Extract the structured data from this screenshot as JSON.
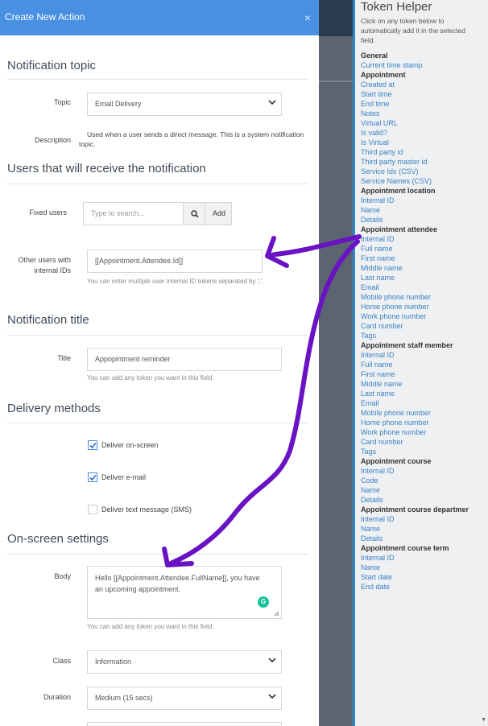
{
  "modal": {
    "title": "Create New Action",
    "close_glyph": "×"
  },
  "notification_topic": {
    "heading": "Notification topic",
    "topic_label": "Topic",
    "topic_value": "Email Delivery",
    "description_label": "Description",
    "description_text": "Used when a user sends a direct message. This is a system notification topic."
  },
  "receivers": {
    "heading": "Users that will receive the notification",
    "fixed_users_label": "Fixed users",
    "search_placeholder": "Type to search...",
    "add_label": "Add",
    "other_users_label": "Other users with internal IDs",
    "other_users_value": "[[Appointment.Attendee.Id]]",
    "other_users_help": "You can enter multiple user internal ID tokens separated by ';'."
  },
  "notification_title": {
    "heading": "Notification title",
    "title_label": "Title",
    "title_value": "Appopintment reminder",
    "title_help": "You can add any token you want in this field."
  },
  "delivery_methods": {
    "heading": "Delivery methods",
    "options": [
      {
        "label": "Deliver on-screen",
        "checked": true
      },
      {
        "label": "Deliver e-mail",
        "checked": true
      },
      {
        "label": "Deliver text message (SMS)",
        "checked": false
      }
    ]
  },
  "onscreen": {
    "heading": "On-screen settings",
    "body_label": "Body",
    "body_value": "Hello [[Appointment.Attendee.FullName]], you have an upcoming appointment.",
    "body_help": "You can add any token you want in this field.",
    "class_label": "Class",
    "class_value": "Information",
    "duration_label": "Duration",
    "duration_value": "Medium (15 secs)"
  },
  "token_helper": {
    "title": "Token Helper",
    "intro": "Click on any token below to automatically add it in the selected field.",
    "groups": [
      {
        "name": "General",
        "tokens": [
          "Current time stamp"
        ]
      },
      {
        "name": "Appointment",
        "tokens": [
          "Created at",
          "Start time",
          "End time",
          "Notes",
          "Virtual URL",
          "Is valid?",
          "Is Virtual",
          "Third party id",
          "Third party master id",
          "Service Ids (CSV)",
          "Service Names (CSV)"
        ]
      },
      {
        "name": "Appointment location",
        "tokens": [
          "Internal ID",
          "Name",
          "Details"
        ]
      },
      {
        "name": "Appointment attendee",
        "tokens": [
          "Internal ID",
          "Full name",
          "First name",
          "Middle name",
          "Last name",
          "Email",
          "Mobile phone number",
          "Home phone number",
          "Work phone number",
          "Card number",
          "Tags"
        ]
      },
      {
        "name": "Appointment staff member",
        "tokens": [
          "Internal ID",
          "Full name",
          "First name",
          "Middle name",
          "Last name",
          "Email",
          "Mobile phone number",
          "Home phone number",
          "Work phone number",
          "Card number",
          "Tags"
        ]
      },
      {
        "name": "Appointment course",
        "tokens": [
          "Internal ID",
          "Code",
          "Name",
          "Details"
        ]
      },
      {
        "name": "Appointment course departmer",
        "tokens": [
          "Internal ID",
          "Name",
          "Details"
        ]
      },
      {
        "name": "Appointment course term",
        "tokens": [
          "Internal ID",
          "Name",
          "Start date",
          "End date"
        ]
      }
    ]
  },
  "icons": {
    "search": "search-icon",
    "chevron": "chevron-down-icon",
    "check": "check-icon",
    "grammarly": "grammarly-icon",
    "annotation": "purple-arrow-annotation"
  },
  "colors": {
    "header": "#4a90e2",
    "link": "#3b82c4",
    "annotation": "#6a13c4",
    "panel_border": "#2f86c9"
  }
}
